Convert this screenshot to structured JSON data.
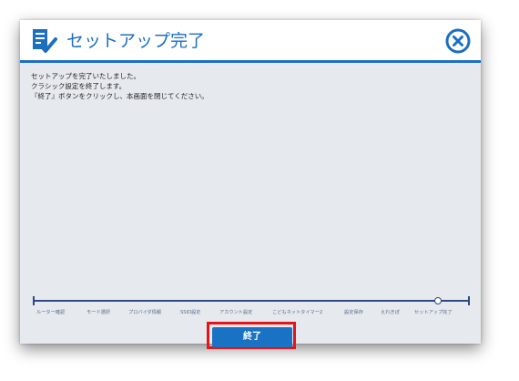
{
  "header": {
    "title": "セットアップ完了",
    "icon": "setup-checklist-icon",
    "close_icon": "close-circle-icon"
  },
  "message": {
    "lines": [
      "セットアップを完了いたしました。",
      "クラシック設定を終了します。",
      "『終了』ボタンをクリックし、本画面を閉じてください。"
    ]
  },
  "progress": {
    "steps": [
      "ルーター確認",
      "モード選択",
      "プロバイダ情報",
      "SSID設定",
      "アカウント設定",
      "こどもネットタイマー2",
      "設定保存",
      "えれきぽ",
      "セットアップ完了"
    ],
    "current_step": "セットアップ完了"
  },
  "buttons": {
    "finish": "終了"
  },
  "colors": {
    "accent": "#1c6fbf",
    "button": "#1a72c4",
    "track": "#2c4a86",
    "highlight": "#e3141a",
    "body_bg": "#e6e9ee"
  }
}
